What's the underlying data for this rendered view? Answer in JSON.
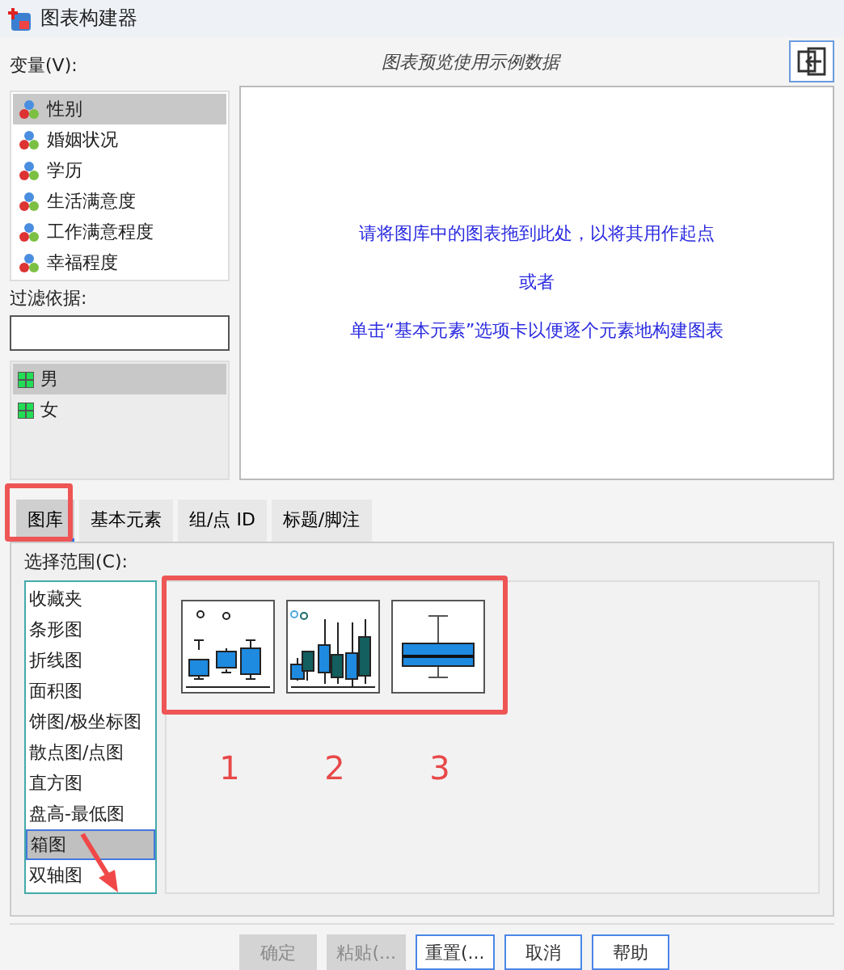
{
  "window": {
    "title": "图表构建器"
  },
  "variables": {
    "label": "变量(V):",
    "items": [
      {
        "name": "性别",
        "selected": true
      },
      {
        "name": "婚姻状况",
        "selected": false
      },
      {
        "name": "学历",
        "selected": false
      },
      {
        "name": "生活满意度",
        "selected": false
      },
      {
        "name": "工作满意程度",
        "selected": false
      },
      {
        "name": "幸福程度",
        "selected": false
      }
    ]
  },
  "preview": {
    "caption": "图表预览使用示例数据",
    "hint_1": "请将图库中的图表拖到此处，以将其用作起点",
    "or": "或者",
    "hint_2": "单击“基本元素”选项卡以便逐个元素地构建图表"
  },
  "filter": {
    "label": "过滤依据:",
    "values": [
      {
        "name": "男",
        "selected": true
      },
      {
        "name": "女",
        "selected": false
      }
    ]
  },
  "tabs": [
    {
      "label": "图库",
      "selected": true
    },
    {
      "label": "基本元素",
      "selected": false
    },
    {
      "label": "组/点 ID",
      "selected": false
    },
    {
      "label": "标题/脚注",
      "selected": false
    }
  ],
  "gallery": {
    "range_label": "选择范围(C):",
    "categories": [
      {
        "name": "收藏夹",
        "selected": false
      },
      {
        "name": "条形图",
        "selected": false
      },
      {
        "name": "折线图",
        "selected": false
      },
      {
        "name": "面积图",
        "selected": false
      },
      {
        "name": "饼图/极坐标图",
        "selected": false
      },
      {
        "name": "散点图/点图",
        "selected": false
      },
      {
        "name": "直方图",
        "selected": false
      },
      {
        "name": "盘高-最低图",
        "selected": false
      },
      {
        "name": "箱图",
        "selected": true
      },
      {
        "name": "双轴图",
        "selected": false
      }
    ],
    "thumbnails": [
      {
        "kind": "simple"
      },
      {
        "kind": "clustered"
      },
      {
        "kind": "one-d"
      }
    ]
  },
  "annotations": {
    "numbers": [
      "1",
      "2",
      "3"
    ]
  },
  "buttons": [
    {
      "label": "确定",
      "disabled": true
    },
    {
      "label": "粘贴(...",
      "disabled": true
    },
    {
      "label": "重置(...",
      "disabled": false
    },
    {
      "label": "取消",
      "disabled": false
    },
    {
      "label": "帮助",
      "disabled": false
    }
  ]
}
